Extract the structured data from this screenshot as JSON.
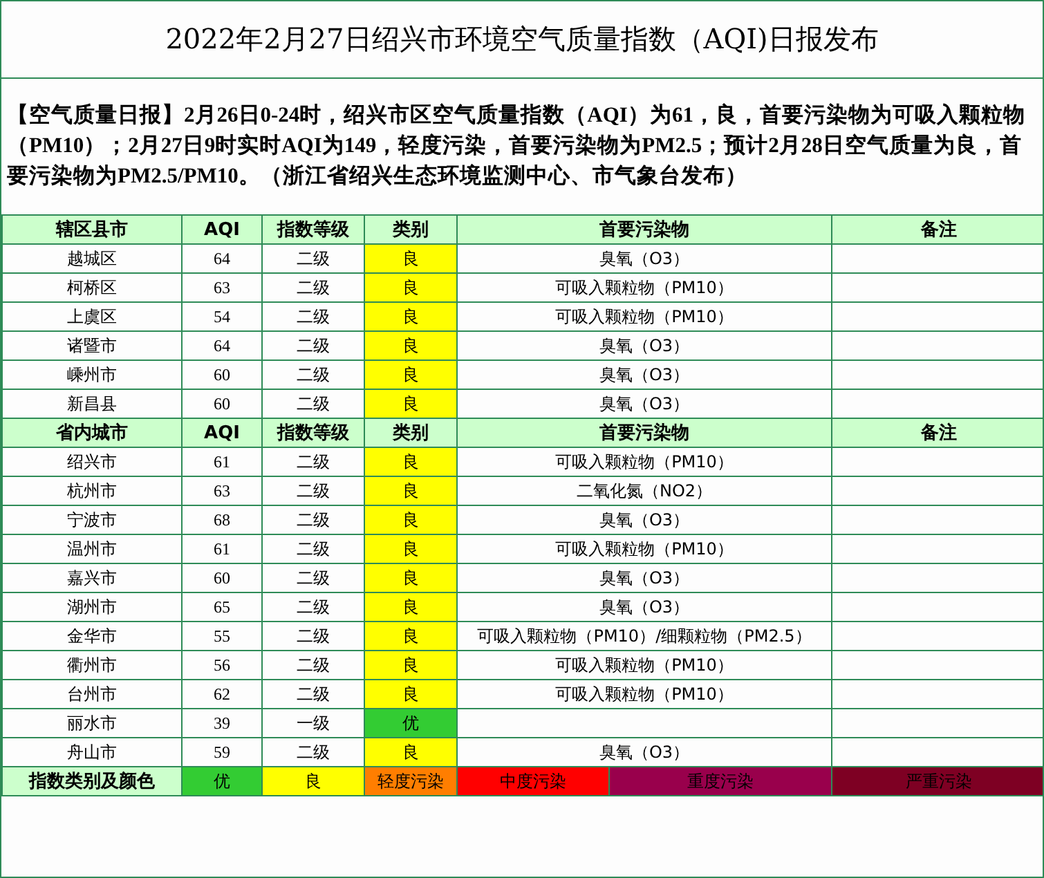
{
  "title": "2022年2月27日绍兴市环境空气质量指数（AQI)日报发布",
  "summary": "【空气质量日报】2月26日0-24时，绍兴市区空气质量指数（AQI）为61，良，首要污染物为可吸入颗粒物（PM10）；2月27日9时实时AQI为149，轻度污染，首要污染物为PM2.5；预计2月28日空气质量为良，首要污染物为PM2.5/PM10。（浙江省绍兴生态环境监测中心、市气象台发布）",
  "sections": [
    {
      "columns": [
        "辖区县市",
        "AQI",
        "指数等级",
        "类别",
        "首要污染物",
        "备注"
      ],
      "rows": [
        {
          "name": "越城区",
          "aqi": "64",
          "grade": "二级",
          "category": "良",
          "color": "#ffff00",
          "pollutant": "臭氧（O3）"
        },
        {
          "name": "柯桥区",
          "aqi": "63",
          "grade": "二级",
          "category": "良",
          "color": "#ffff00",
          "pollutant": "可吸入颗粒物（PM10）"
        },
        {
          "name": "上虞区",
          "aqi": "54",
          "grade": "二级",
          "category": "良",
          "color": "#ffff00",
          "pollutant": "可吸入颗粒物（PM10）"
        },
        {
          "name": "诸暨市",
          "aqi": "64",
          "grade": "二级",
          "category": "良",
          "color": "#ffff00",
          "pollutant": "臭氧（O3）"
        },
        {
          "name": "嵊州市",
          "aqi": "60",
          "grade": "二级",
          "category": "良",
          "color": "#ffff00",
          "pollutant": "臭氧（O3）"
        },
        {
          "name": "新昌县",
          "aqi": "60",
          "grade": "二级",
          "category": "良",
          "color": "#ffff00",
          "pollutant": "臭氧（O3）"
        }
      ]
    },
    {
      "columns": [
        "省内城市",
        "AQI",
        "指数等级",
        "类别",
        "首要污染物",
        "备注"
      ],
      "rows": [
        {
          "name": "绍兴市",
          "aqi": "61",
          "grade": "二级",
          "category": "良",
          "color": "#ffff00",
          "pollutant": "可吸入颗粒物（PM10）"
        },
        {
          "name": "杭州市",
          "aqi": "63",
          "grade": "二级",
          "category": "良",
          "color": "#ffff00",
          "pollutant": "二氧化氮（NO2）"
        },
        {
          "name": "宁波市",
          "aqi": "68",
          "grade": "二级",
          "category": "良",
          "color": "#ffff00",
          "pollutant": "臭氧（O3）"
        },
        {
          "name": "温州市",
          "aqi": "61",
          "grade": "二级",
          "category": "良",
          "color": "#ffff00",
          "pollutant": "可吸入颗粒物（PM10）"
        },
        {
          "name": "嘉兴市",
          "aqi": "60",
          "grade": "二级",
          "category": "良",
          "color": "#ffff00",
          "pollutant": "臭氧（O3）"
        },
        {
          "name": "湖州市",
          "aqi": "65",
          "grade": "二级",
          "category": "良",
          "color": "#ffff00",
          "pollutant": "臭氧（O3）"
        },
        {
          "name": "金华市",
          "aqi": "55",
          "grade": "二级",
          "category": "良",
          "color": "#ffff00",
          "pollutant": "可吸入颗粒物（PM10）/细颗粒物（PM2.5）"
        },
        {
          "name": "衢州市",
          "aqi": "56",
          "grade": "二级",
          "category": "良",
          "color": "#ffff00",
          "pollutant": "可吸入颗粒物（PM10）"
        },
        {
          "name": "台州市",
          "aqi": "62",
          "grade": "二级",
          "category": "良",
          "color": "#ffff00",
          "pollutant": "可吸入颗粒物（PM10）"
        },
        {
          "name": "丽水市",
          "aqi": "39",
          "grade": "一级",
          "category": "优",
          "color": "#33cc33",
          "pollutant": ""
        },
        {
          "name": "舟山市",
          "aqi": "59",
          "grade": "二级",
          "category": "良",
          "color": "#ffff00",
          "pollutant": "臭氧（O3）"
        }
      ]
    }
  ],
  "legend": {
    "label": "指数类别及颜色",
    "items": [
      {
        "label": "优",
        "color": "#33cc33"
      },
      {
        "label": "良",
        "color": "#ffff00"
      },
      {
        "label": "轻度污染",
        "color": "#ff7e00"
      },
      {
        "label": "中度污染",
        "color": "#ff0000"
      },
      {
        "label": "重度污染",
        "color": "#99004c"
      },
      {
        "label": "严重污染",
        "color": "#7e0023"
      }
    ]
  }
}
